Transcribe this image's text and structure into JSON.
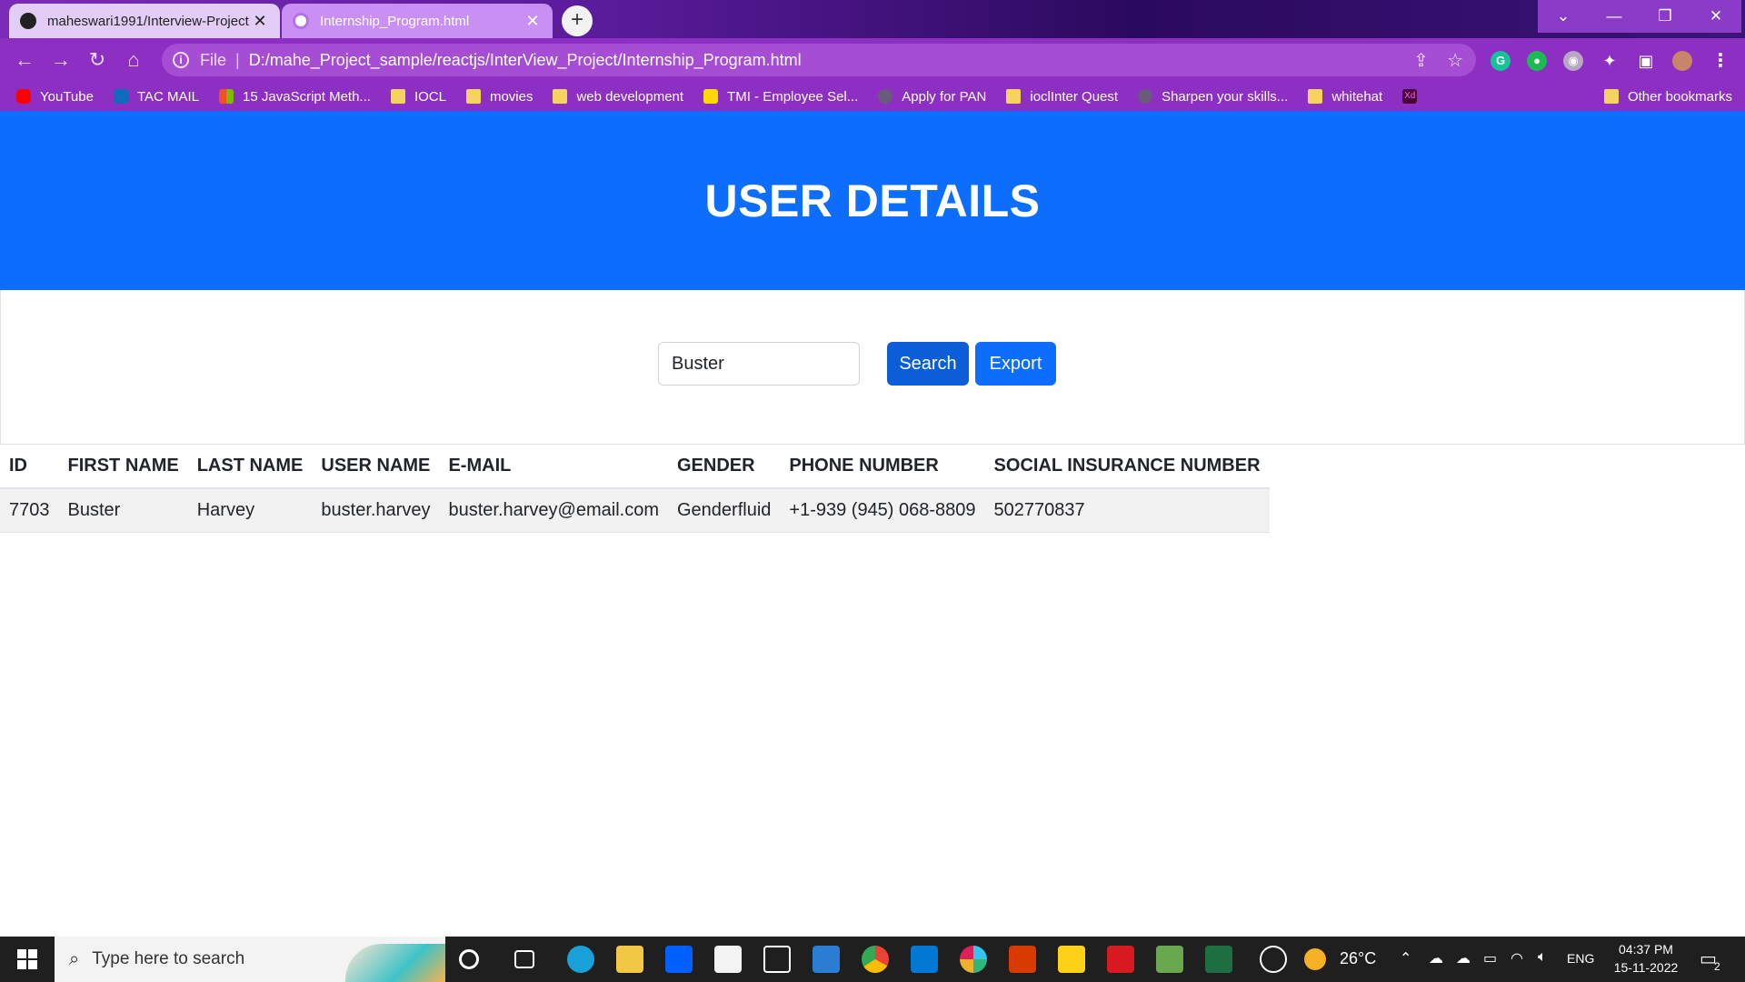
{
  "browser": {
    "tabs": [
      {
        "title": "maheswari1991/Interview-Project",
        "active": false
      },
      {
        "title": "Internship_Program.html",
        "active": true
      }
    ],
    "new_tab_label": "+",
    "address": {
      "scheme_label": "File",
      "url": "D:/mahe_Project_sample/reactjs/InterView_Project/Internship_Program.html"
    },
    "bookmarks": [
      {
        "label": "YouTube",
        "icon": "youtube-icon"
      },
      {
        "label": "TAC MAIL",
        "icon": "outlook-icon"
      },
      {
        "label": "15 JavaScript Meth...",
        "icon": "windows-icon"
      },
      {
        "label": "IOCL",
        "icon": "folder-icon"
      },
      {
        "label": "movies",
        "icon": "folder-icon"
      },
      {
        "label": "web development",
        "icon": "folder-icon"
      },
      {
        "label": "TMI - Employee Sel...",
        "icon": "tmi-icon"
      },
      {
        "label": "Apply for PAN",
        "icon": "globe-icon"
      },
      {
        "label": "ioclInter Quest",
        "icon": "folder-icon"
      },
      {
        "label": "Sharpen your skills...",
        "icon": "globe-icon"
      },
      {
        "label": "whitehat",
        "icon": "folder-icon"
      },
      {
        "label": "",
        "icon": "xd-icon"
      }
    ],
    "other_bookmarks": "Other bookmarks"
  },
  "page": {
    "title": "USER DETAILS",
    "search": {
      "value": "Buster",
      "button": "Search",
      "export_button": "Export"
    },
    "table": {
      "headers": [
        "ID",
        "FIRST NAME",
        "LAST NAME",
        "USER NAME",
        "E-MAIL",
        "GENDER",
        "PHONE NUMBER",
        "SOCIAL INSURANCE NUMBER"
      ],
      "rows": [
        [
          "7703",
          "Buster",
          "Harvey",
          "buster.harvey",
          "buster.harvey@email.com",
          "Genderfluid",
          "+1-939 (945) 068-8809",
          "502770837"
        ]
      ]
    }
  },
  "taskbar": {
    "search_placeholder": "Type here to search",
    "weather": "26°C",
    "language": "ENG",
    "time": "04:37 PM",
    "date": "15-11-2022",
    "notifications": "2"
  },
  "colors": {
    "brand_purple": "#8e2fc4",
    "hero_blue": "#0d6efd",
    "button_blue": "#0d6efd",
    "button_active": "#0b5ed7"
  }
}
